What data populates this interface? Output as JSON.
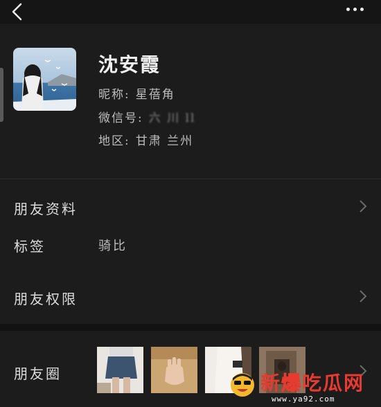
{
  "profile": {
    "name": "沈安霞",
    "nickname_label": "昵称:",
    "nickname": "星蓓角",
    "wechat_label": "微信号:",
    "wechat_id": "六 川 ll",
    "region_label": "地区:",
    "region": "甘肃 兰州"
  },
  "rows": {
    "friend_info": "朋友资料",
    "tags_label": "标签",
    "tags_value": "骑比",
    "permissions": "朋友权限",
    "moments": "朋友圈"
  },
  "moments_thumbs": [
    "photo-skirt-legs",
    "photo-hand",
    "photo-white-dress",
    "photo-doorway"
  ],
  "watermark": {
    "brand": "新爆吃瓜网",
    "brand_part1": "新",
    "brand_part2": "爆",
    "brand_part3": "吃瓜网",
    "url": "www.ya92.com"
  },
  "colors": {
    "background": "#1c1c1c",
    "text": "#d8d8d8",
    "watermark_red": "#e83a2e"
  }
}
